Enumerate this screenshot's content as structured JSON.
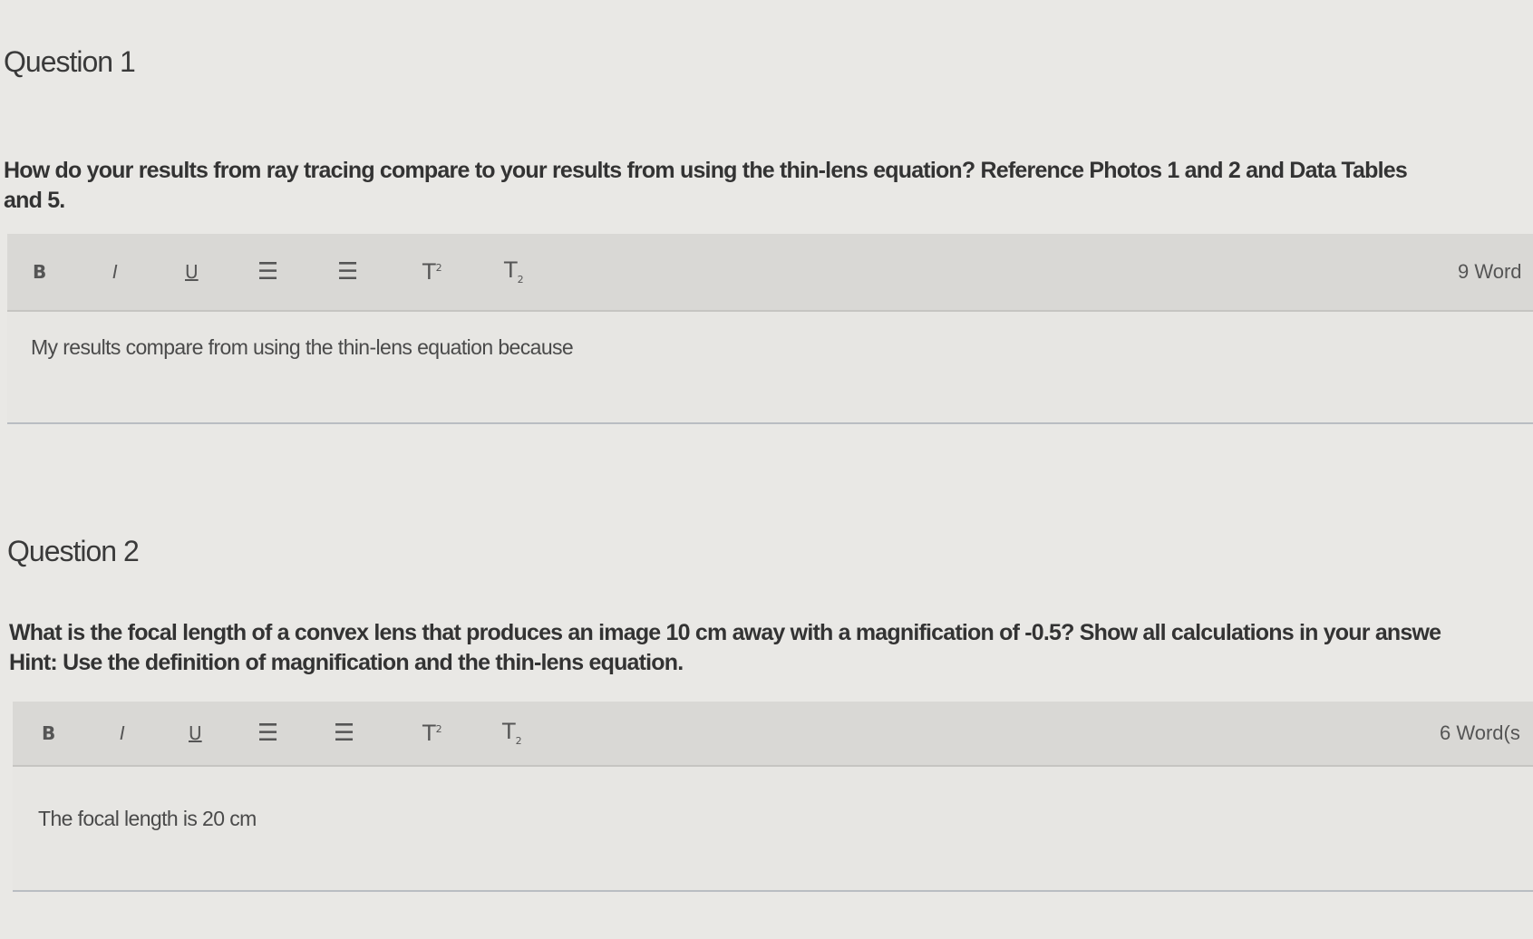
{
  "question1": {
    "title": "Question 1",
    "prompt_line1": "How do your results from ray tracing compare to your results from using the thin-lens equation? Reference Photos 1 and 2 and Data Tables",
    "prompt_line2": "and 5.",
    "toolbar": {
      "bold": "B",
      "italic": "I",
      "underline": "U",
      "bullet_list": "☰",
      "numbered_list": "☰",
      "superscript": "T",
      "subscript": "T"
    },
    "word_count": "9 Word",
    "answer": "My results compare from using the thin-lens equation because"
  },
  "question2": {
    "title": "Question 2",
    "prompt_line1": "What is the focal length of a convex lens that produces an image 10 cm away with a magnification of -0.5? Show all calculations in your answe",
    "prompt_line2": "Hint: Use the definition of magnification and the thin-lens equation.",
    "toolbar": {
      "bold": "B",
      "italic": "I",
      "underline": "U",
      "bullet_list": "☰",
      "numbered_list": "☰",
      "superscript": "T",
      "subscript": "T"
    },
    "word_count": "6 Word(s",
    "answer": "The focal length is 20 cm"
  },
  "colors": {
    "page_bg": "#e9e8e5",
    "toolbar_bg": "#d9d8d5",
    "text": "#333333"
  }
}
